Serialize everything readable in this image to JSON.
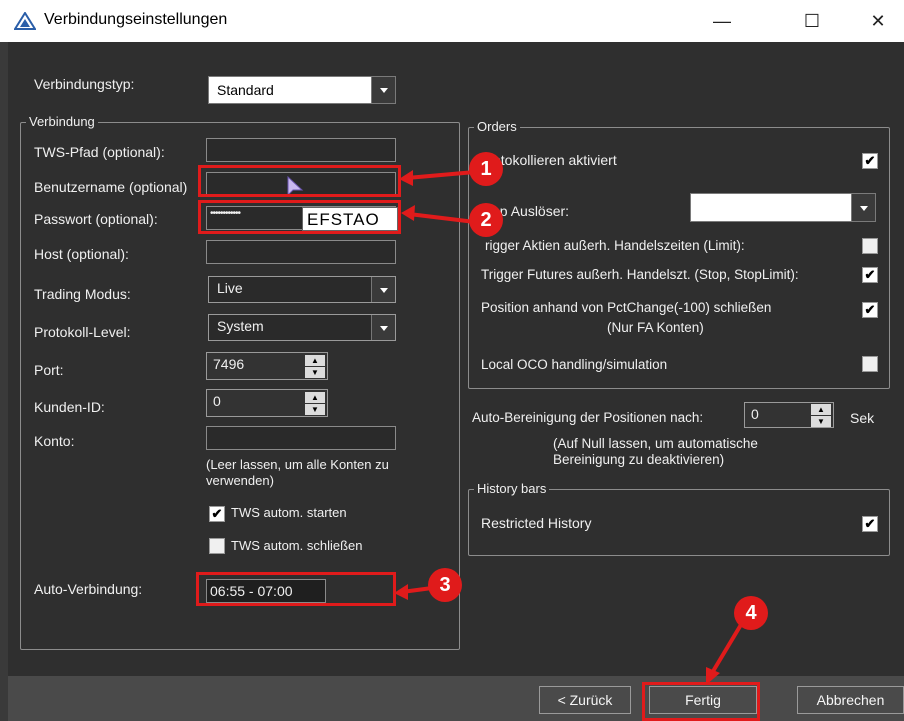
{
  "window": {
    "title": "Verbindungseinstellungen",
    "minimize": "—",
    "maximize": "☐",
    "close": "✕"
  },
  "connection_type": {
    "label": "Verbindungstyp:",
    "value": "Standard"
  },
  "verbindung": {
    "title": "Verbindung",
    "tws_path_label": "TWS-Pfad (optional):",
    "username_label": "Benutzername (optional)",
    "password_label": "Passwort (optional):",
    "password_value": "••••••••••••",
    "password_tooltip": "EFSTAO",
    "host_label": "Host (optional):",
    "trading_mode_label": "Trading Modus:",
    "trading_mode_value": "Live",
    "log_level_label": "Protokoll-Level:",
    "log_level_value": "System",
    "port_label": "Port:",
    "port_value": "7496",
    "client_id_label": "Kunden-ID:",
    "client_id_value": "0",
    "account_label": "Konto:",
    "account_hint": "(Leer lassen, um alle Konten zu verwenden)",
    "tws_autostart_label": "TWS autom. starten",
    "tws_autostart_checked": true,
    "tws_autoclose_label": "TWS autom. schließen",
    "tws_autoclose_checked": false,
    "auto_connect_label": "Auto-Verbindung:",
    "auto_connect_value": "06:55 - 07:00"
  },
  "orders": {
    "title": "Orders",
    "log_enabled_label": "Protokollieren aktiviert",
    "log_enabled_visible": "otokollieren aktiviert",
    "stop_trigger_label": "Stop Auslöser:",
    "stop_trigger_visible": "op Auslöser:",
    "trigger_stocks_label": "Trigger Aktien außerh. Handelszeiten (Limit):",
    "trigger_stocks_visible": "rigger Aktien außerh. Handelszeiten (Limit):",
    "trigger_futures_label": "Trigger Futures außerh. Handelszt. (Stop, StopLimit):",
    "position_close_label": "Position anhand von PctChange(-100) schließen",
    "position_close_note": "(Nur FA Konten)",
    "local_oco_label": "Local OCO handling/simulation"
  },
  "auto_cleanup": {
    "label": "Auto-Bereinigung der Positionen nach:",
    "value": "0",
    "unit": "Sek",
    "hint_line1": "(Auf Null lassen, um automatische",
    "hint_line2": "Bereinigung zu deaktivieren)"
  },
  "history": {
    "title": "History bars",
    "restricted_label": "Restricted History"
  },
  "buttons": {
    "back": "< Zurück",
    "finish": "Fertig",
    "cancel": "Abbrechen"
  },
  "annotations": {
    "badge1": "1",
    "badge2": "2",
    "badge3": "3",
    "badge4": "4"
  },
  "colors": {
    "annotation_red": "#e01b1b",
    "background": "#2f2f2f"
  },
  "icons": {
    "app": "triangle-app-icon",
    "checkmark": "check-icon",
    "dropdown": "chevron-down-icon"
  }
}
